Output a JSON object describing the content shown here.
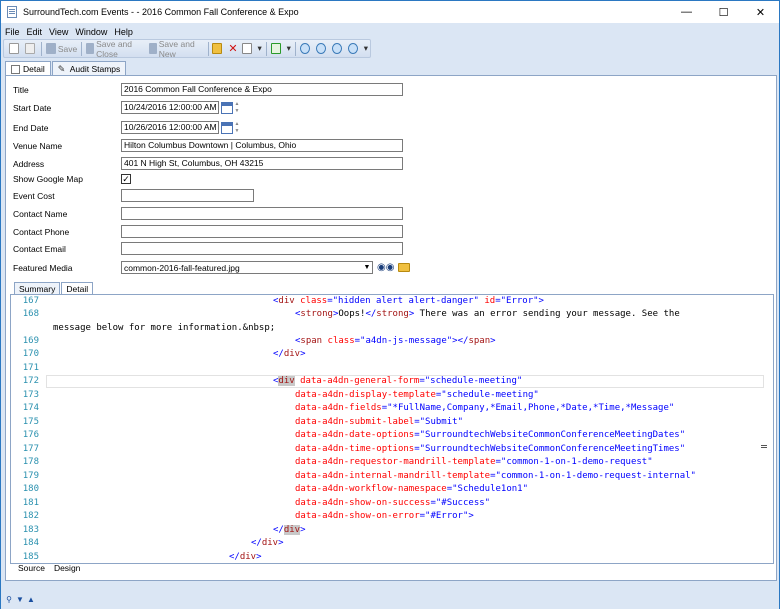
{
  "window": {
    "title": "SurroundTech.com Events - - 2016 Common Fall Conference & Expo"
  },
  "menu": [
    "File",
    "Edit",
    "View",
    "Window",
    "Help"
  ],
  "toolbar": {
    "save": "Save",
    "save_close": "Save and Close",
    "save_new": "Save and New"
  },
  "tabs": {
    "detail": "Detail",
    "audit": "Audit Stamps"
  },
  "form": {
    "title_label": "Title",
    "title_value": "2016 Common Fall Conference & Expo",
    "start_label": "Start Date",
    "start_value": "10/24/2016 12:00:00 AM",
    "end_label": "End Date",
    "end_value": "10/26/2016 12:00:00 AM",
    "venue_label": "Venue Name",
    "venue_value": "Hilton Columbus Downtown | Columbus, Ohio",
    "address_label": "Address",
    "address_value": "401 N High St, Columbus, OH 43215",
    "map_label": "Show Google Map",
    "map_checked": "✓",
    "cost_label": "Event Cost",
    "cost_value": "",
    "contact_name_label": "Contact Name",
    "contact_name_value": "",
    "contact_phone_label": "Contact Phone",
    "contact_phone_value": "",
    "contact_email_label": "Contact Email",
    "contact_email_value": "",
    "media_label": "Featured Media",
    "media_value": "common-2016-fall-featured.jpg"
  },
  "inner_tabs": {
    "summary": "Summary",
    "detail": "Detail"
  },
  "editor": {
    "line_numbers": [
      "167",
      "168",
      "",
      "169",
      "170",
      "171",
      "172",
      "173",
      "174",
      "175",
      "176",
      "177",
      "178",
      "179",
      "180",
      "181",
      "182",
      "183",
      "184",
      "185"
    ]
  },
  "bottom_tabs": {
    "source": "Source",
    "design": "Design"
  }
}
